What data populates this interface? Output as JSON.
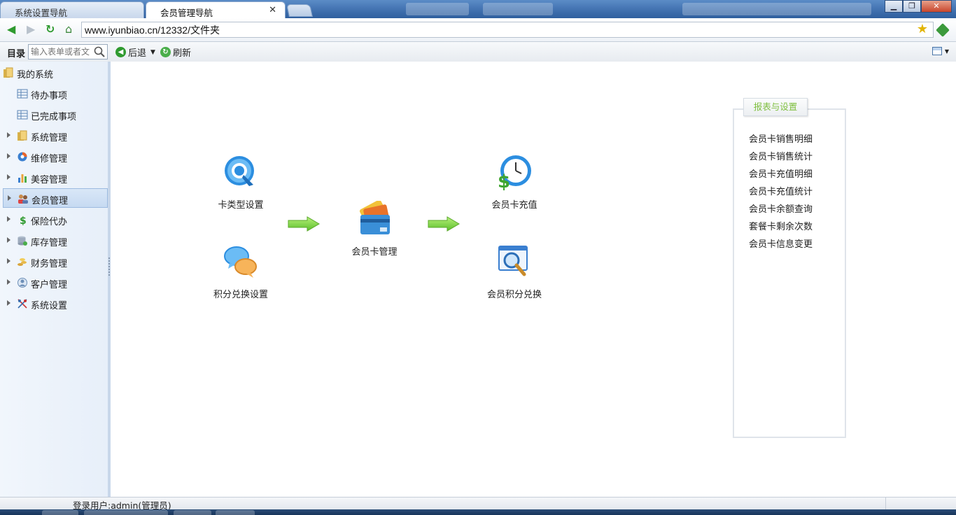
{
  "tabs": [
    {
      "label": "系统设置导航",
      "active": false
    },
    {
      "label": "会员管理导航",
      "active": true
    }
  ],
  "address": {
    "url": "www.iyunbiao.cn/12332/文件夹"
  },
  "toolbar": {
    "title": "目录",
    "search_placeholder": "输入表单或者文件",
    "back_label": "后退",
    "refresh_label": "刷新"
  },
  "sidebar": {
    "root": "我的系统",
    "items": [
      {
        "label": "待办事项",
        "icon": "table-icon"
      },
      {
        "label": "已完成事项",
        "icon": "table-icon"
      },
      {
        "label": "系统管理",
        "icon": "folder-icon"
      },
      {
        "label": "维修管理",
        "icon": "pie-chart-icon"
      },
      {
        "label": "美容管理",
        "icon": "bar-chart-icon"
      },
      {
        "label": "会员管理",
        "icon": "members-icon",
        "selected": true
      },
      {
        "label": "保险代办",
        "icon": "dollar-icon"
      },
      {
        "label": "库存管理",
        "icon": "database-icon"
      },
      {
        "label": "财务管理",
        "icon": "coins-icon"
      },
      {
        "label": "客户管理",
        "icon": "customer-icon"
      },
      {
        "label": "系统设置",
        "icon": "settings-icon"
      }
    ]
  },
  "flow": {
    "card_type": "卡类型设置",
    "points_exchange_setup": "积分兑换设置",
    "card_manage": "会员卡管理",
    "recharge": "会员卡充值",
    "points_exchange": "会员积分兑换"
  },
  "report_panel": {
    "title": "报表与设置",
    "links": [
      "会员卡销售明细",
      "会员卡销售统计",
      "会员卡充值明细",
      "会员卡充值统计",
      "会员卡余额查询",
      "套餐卡剩余次数",
      "会员卡信息变更"
    ]
  },
  "status": {
    "user": "登录用户:admin(管理员)"
  }
}
